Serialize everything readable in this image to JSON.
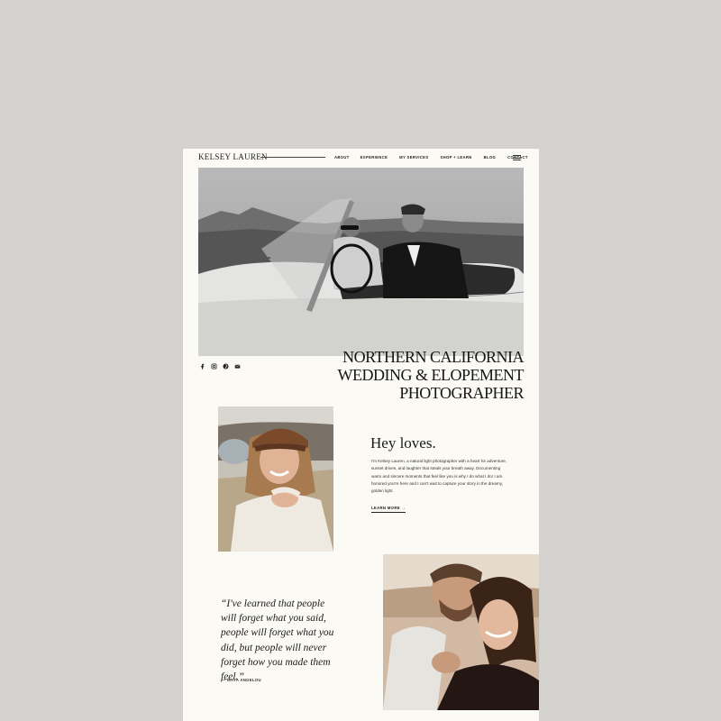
{
  "brand": {
    "name": "KELSEY LAUREN"
  },
  "nav": {
    "items": [
      "ABOUT",
      "EXPERIENCE",
      "MY SERVICES",
      "SHOP + LEARN",
      "BLOG",
      "CONTACT"
    ]
  },
  "hero": {
    "title_lines": [
      "NORTHERN CALIFORNIA",
      "WEDDING & ELOPEMENT",
      "PHOTOGRAPHER"
    ],
    "social_icons": [
      "facebook-icon",
      "instagram-icon",
      "pinterest-icon",
      "email-icon"
    ]
  },
  "about": {
    "heading": "Hey loves.",
    "bio": "I'm Kelsey Lauren, a natural light photographer with a heart for adventure, sunset drives, and laughter that steals your breath away. Documenting warm and sincere moments that feel like you is why I do what I do! I am honored you're here and I can't wait to capture your story in the dreamy, golden light.",
    "cta": "LEARN MORE →"
  },
  "quote": {
    "text": "“I've learned that people will forget what you said, people will forget what you did, but people will never forget how you made them feel.”",
    "author": "— MAYA ANGELOU"
  },
  "colors": {
    "background": "#d3d2ce",
    "page": "#fbfaf5",
    "text": "#1a1a1a"
  }
}
